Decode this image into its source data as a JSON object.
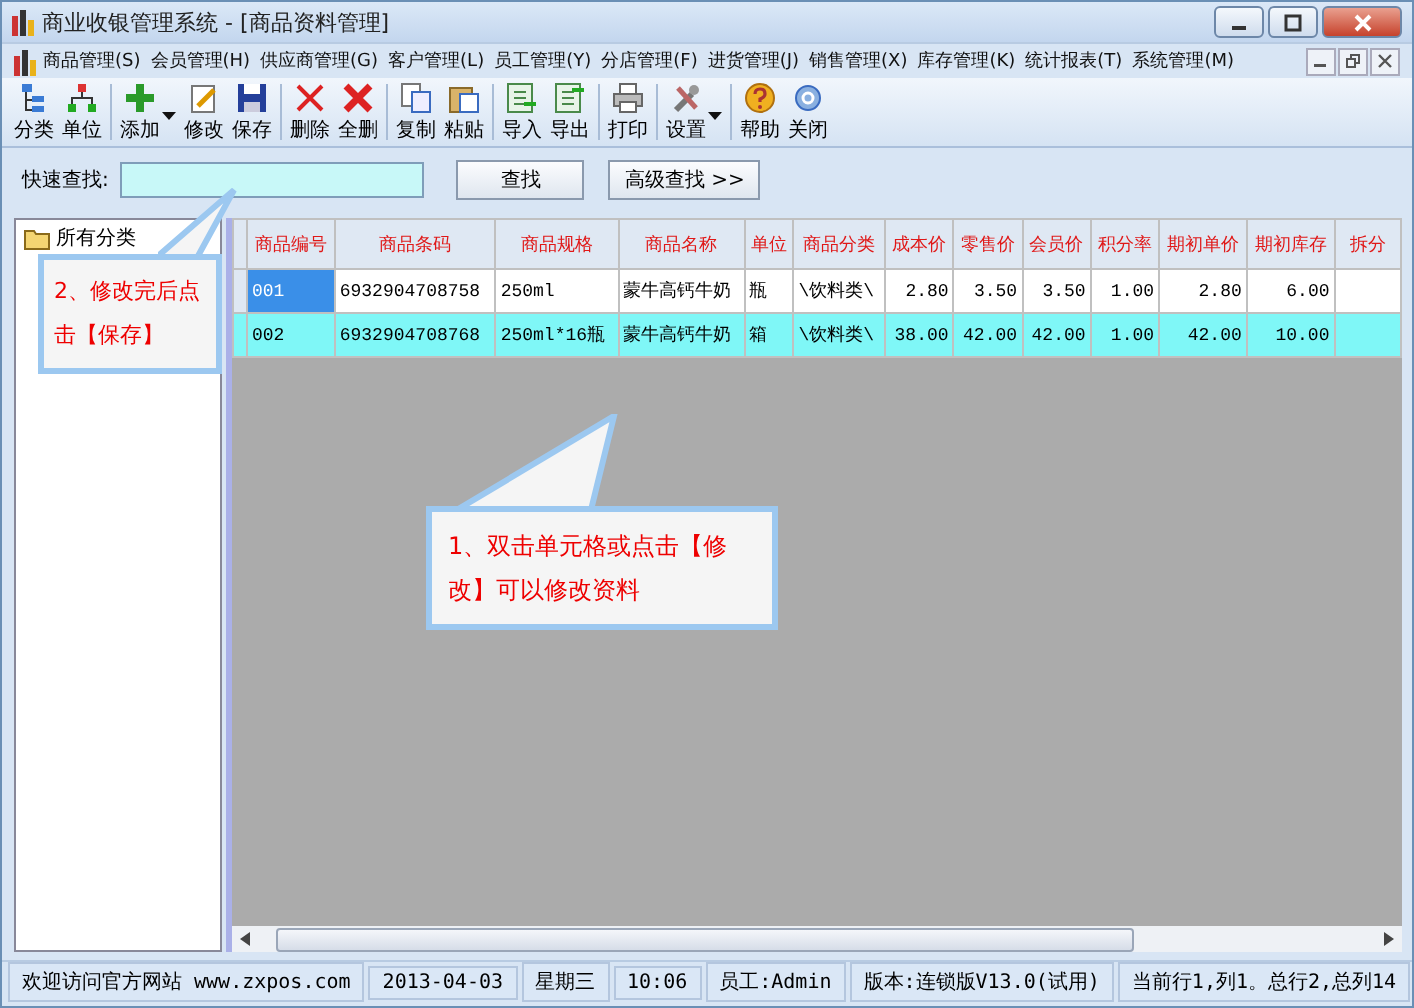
{
  "window": {
    "title": "商业收银管理系统 - [商品资料管理]"
  },
  "menu": [
    "商品管理(S)",
    "会员管理(H)",
    "供应商管理(G)",
    "客户管理(L)",
    "员工管理(Y)",
    "分店管理(F)",
    "进货管理(J)",
    "销售管理(X)",
    "库存管理(K)",
    "统计报表(T)",
    "系统管理(M)"
  ],
  "toolbar": [
    [
      {
        "label": "分类",
        "dropdown": false
      },
      {
        "label": "单位",
        "dropdown": false
      }
    ],
    [
      {
        "label": "添加",
        "dropdown": true
      },
      {
        "label": "修改",
        "dropdown": false
      },
      {
        "label": "保存",
        "dropdown": false
      }
    ],
    [
      {
        "label": "删除",
        "dropdown": false
      },
      {
        "label": "全删",
        "dropdown": false
      }
    ],
    [
      {
        "label": "复制",
        "dropdown": false
      },
      {
        "label": "粘贴",
        "dropdown": false
      }
    ],
    [
      {
        "label": "导入",
        "dropdown": false
      },
      {
        "label": "导出",
        "dropdown": false
      }
    ],
    [
      {
        "label": "打印",
        "dropdown": false
      }
    ],
    [
      {
        "label": "设置",
        "dropdown": true
      }
    ],
    [
      {
        "label": "帮助",
        "dropdown": false
      },
      {
        "label": "关闭",
        "dropdown": false
      }
    ]
  ],
  "search": {
    "label": "快速查找:",
    "buttons": [
      "查找",
      "高级查找 >>"
    ]
  },
  "tree": {
    "items": [
      {
        "label": "所有分类"
      }
    ]
  },
  "table": {
    "columns": [
      "商品编号",
      "商品条码",
      "商品规格",
      "商品名称",
      "单位",
      "商品分类",
      "成本价",
      "零售价",
      "会员价",
      "积分率",
      "期初单价",
      "期初库存",
      "拆分"
    ],
    "rows": [
      {
        "selected": true,
        "shaded": false,
        "cells": [
          "001",
          "6932904708758",
          "250ml",
          "蒙牛高钙牛奶",
          "瓶",
          "\\饮料类\\",
          "2.80",
          "3.50",
          "3.50",
          "1.00",
          "2.80",
          "6.00",
          ""
        ]
      },
      {
        "selected": false,
        "shaded": true,
        "cells": [
          "002",
          "6932904708768",
          "250ml*16瓶",
          "蒙牛高钙牛奶",
          "箱",
          "\\饮料类\\",
          "38.00",
          "42.00",
          "42.00",
          "1.00",
          "42.00",
          "10.00",
          ""
        ]
      }
    ]
  },
  "callouts": [
    {
      "text": "2、修改完后点击【保存】"
    },
    {
      "text": "1、双击单元格或点击【修改】可以修改资料"
    }
  ],
  "status_bar": [
    "欢迎访问官方网站 www.zxpos.com",
    "2013-04-03",
    "星期三",
    "10:06",
    "员工:Admin",
    "版本:连锁版V13.0(试用)",
    "当前行1,列1。总行2,总列14"
  ]
}
